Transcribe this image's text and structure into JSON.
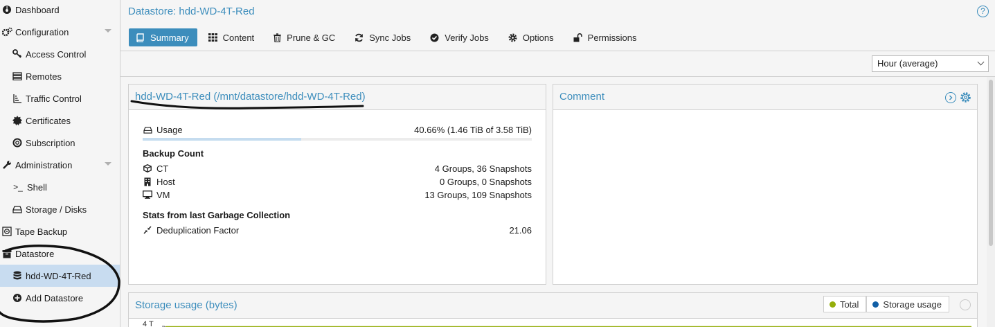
{
  "sidebar": {
    "items": [
      {
        "label": "Dashboard",
        "icon": "dashboard-icon"
      },
      {
        "label": "Configuration",
        "icon": "cogs-icon"
      },
      {
        "label": "Access Control",
        "icon": "key-icon"
      },
      {
        "label": "Remotes",
        "icon": "server-icon"
      },
      {
        "label": "Traffic Control",
        "icon": "signal-icon"
      },
      {
        "label": "Certificates",
        "icon": "certificate-icon"
      },
      {
        "label": "Subscription",
        "icon": "support-icon"
      },
      {
        "label": "Administration",
        "icon": "wrench-icon"
      },
      {
        "label": "Shell",
        "icon": "terminal-icon"
      },
      {
        "label": "Storage / Disks",
        "icon": "hdd-icon"
      },
      {
        "label": "Tape Backup",
        "icon": "tape-icon"
      },
      {
        "label": "Datastore",
        "icon": "archive-icon"
      },
      {
        "label": "hdd-WD-4T-Red",
        "icon": "database-icon"
      },
      {
        "label": "Add Datastore",
        "icon": "plus-circle-icon"
      }
    ]
  },
  "header": {
    "title": "Datastore: hdd-WD-4T-Red",
    "help": "?",
    "tabs": [
      {
        "label": "Summary",
        "icon": "book-icon"
      },
      {
        "label": "Content",
        "icon": "th-icon"
      },
      {
        "label": "Prune & GC",
        "icon": "trash-icon"
      },
      {
        "label": "Sync Jobs",
        "icon": "refresh-icon"
      },
      {
        "label": "Verify Jobs",
        "icon": "check-circle-icon"
      },
      {
        "label": "Options",
        "icon": "gear-icon"
      },
      {
        "label": "Permissions",
        "icon": "unlock-icon"
      }
    ]
  },
  "toolbar": {
    "timeframe": "Hour (average)"
  },
  "summary": {
    "title": "hdd-WD-4T-Red (/mnt/datastore/hdd-WD-4T-Red)",
    "usage_label": "Usage",
    "usage_value": "40.66% (1.46 TiB of 3.58 TiB)",
    "usage_fraction": 0.4066,
    "backup_count_title": "Backup Count",
    "counts": [
      {
        "label": "CT",
        "value": "4 Groups, 36 Snapshots",
        "icon": "cube-icon"
      },
      {
        "label": "Host",
        "value": "0 Groups, 0 Snapshots",
        "icon": "building-icon"
      },
      {
        "label": "VM",
        "value": "13 Groups, 109 Snapshots",
        "icon": "desktop-icon"
      }
    ],
    "gc_title": "Stats from last Garbage Collection",
    "dedup_label": "Deduplication Factor",
    "dedup_value": "21.06"
  },
  "comment": {
    "title": "Comment"
  },
  "storage": {
    "title": "Storage usage (bytes)",
    "legend": [
      {
        "label": "Total",
        "color": "#94ae0a"
      },
      {
        "label": "Storage usage",
        "color": "#115fa6"
      }
    ],
    "y_tick": "4 T"
  },
  "colors": {
    "accent": "#3c8dbc",
    "selected": "#c8dcf0"
  }
}
